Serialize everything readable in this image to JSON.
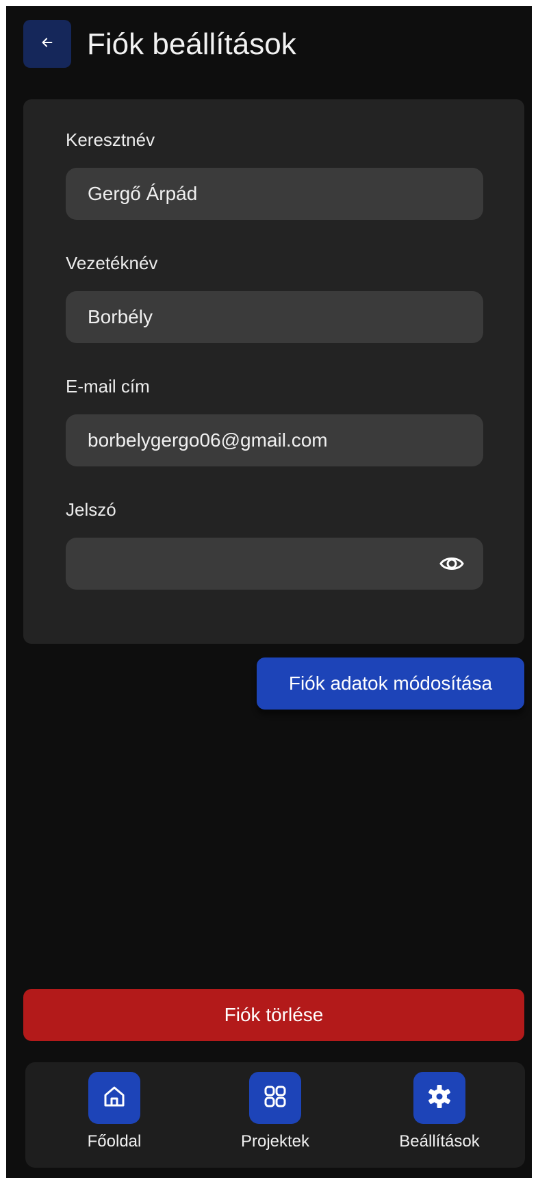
{
  "header": {
    "title": "Fiók beállítások",
    "back_icon": "arrow-left-icon"
  },
  "form": {
    "first_name": {
      "label": "Keresztnév",
      "value": "Gergő Árpád"
    },
    "last_name": {
      "label": "Vezetéknév",
      "value": "Borbély"
    },
    "email": {
      "label": "E-mail cím",
      "value": "borbelygergo06@gmail.com"
    },
    "password": {
      "label": "Jelszó",
      "value": "",
      "toggle_icon": "eye-icon"
    }
  },
  "actions": {
    "update_label": "Fiók adatok módosítása",
    "delete_label": "Fiók törlése"
  },
  "nav": {
    "items": [
      {
        "label": "Főoldal",
        "icon": "home-icon"
      },
      {
        "label": "Projektek",
        "icon": "grid-icon"
      },
      {
        "label": "Beállítások",
        "icon": "gear-icon"
      }
    ]
  },
  "colors": {
    "background": "#0e0e0e",
    "card": "#232323",
    "input": "#3b3b3b",
    "accent": "#1d44b8",
    "danger": "#b31a1a"
  }
}
